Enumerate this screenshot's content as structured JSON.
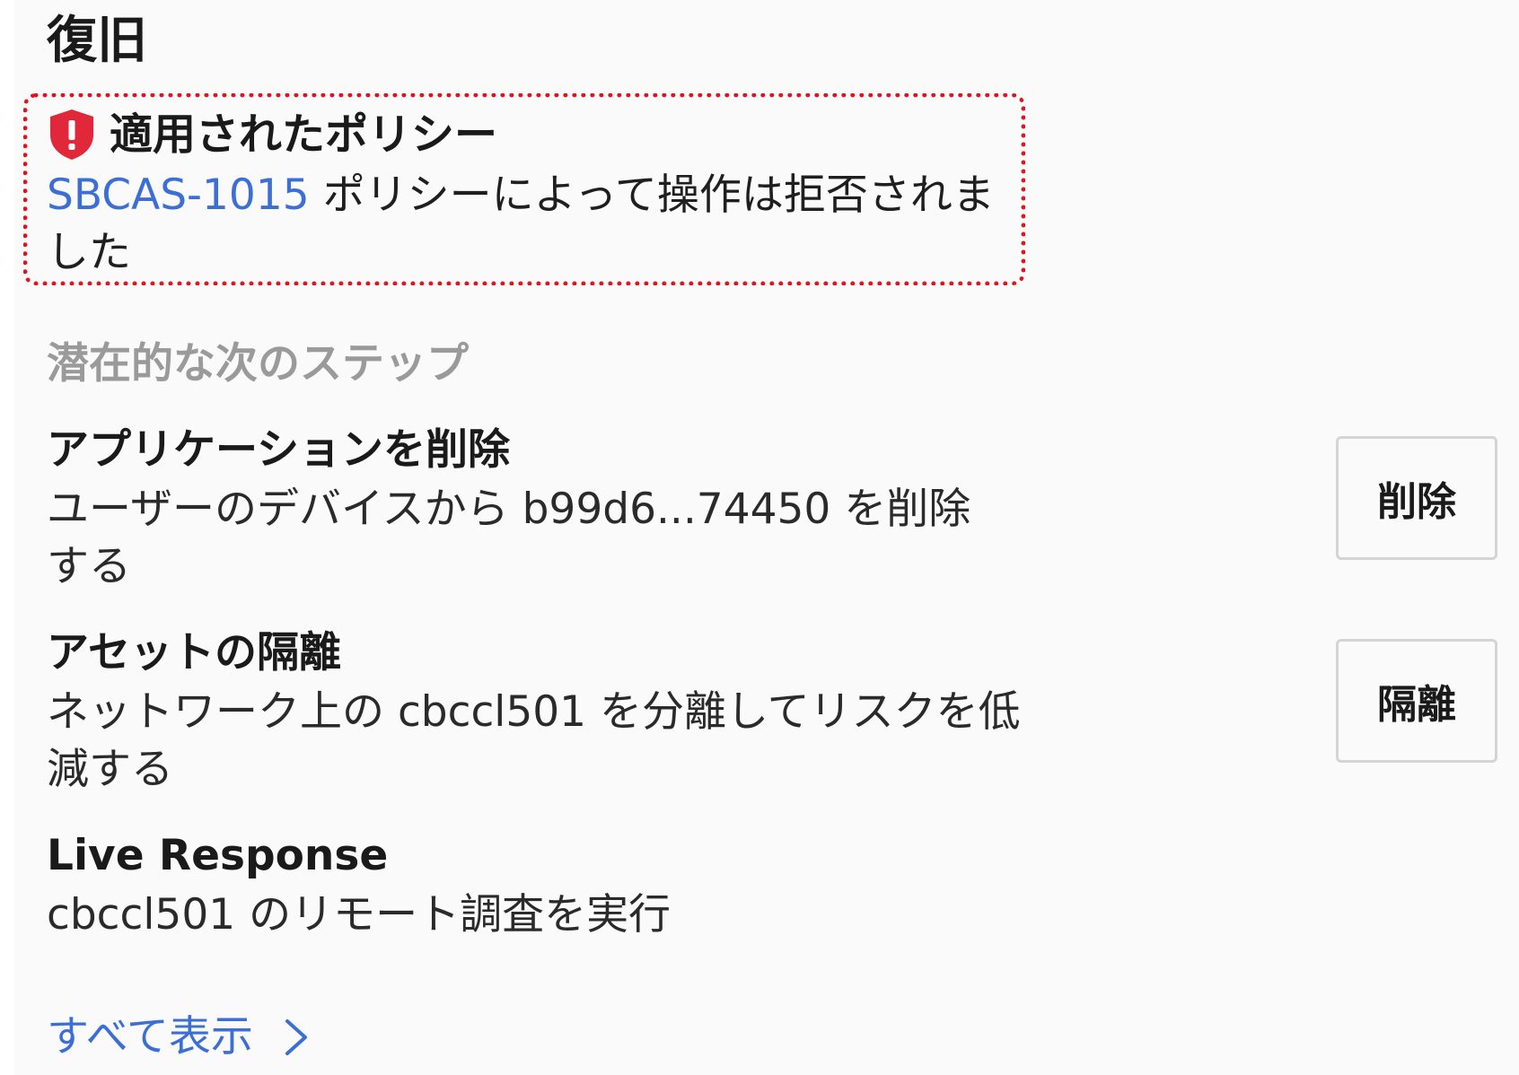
{
  "page": {
    "title": "復旧"
  },
  "policy": {
    "title": "適用されたポリシー",
    "icon": "shield-alert-icon",
    "link_text": "SBCAS-1015",
    "description": " ポリシーによって操作は拒否されました",
    "border_color": "#e0141e",
    "icon_color": "#e0283a"
  },
  "next_steps": {
    "heading": "潜在的な次のステップ",
    "items": [
      {
        "title": "アプリケーションを削除",
        "description": "ユーザーのデバイスから b99d6...74450 を削除する",
        "button_label": "削除"
      },
      {
        "title": "アセットの隔離",
        "description": "ネットワーク上の cbccl501 を分離してリスクを低減する",
        "button_label": "隔離"
      },
      {
        "title": "Live Response",
        "description": "cbccl501 のリモート調査を実行"
      }
    ]
  },
  "view_all": {
    "label": "すべて表示",
    "icon": "chevron-right-icon"
  },
  "colors": {
    "link": "#3b6fd6",
    "muted_heading": "#9a9a9a",
    "panel_background": "#fafafa"
  }
}
